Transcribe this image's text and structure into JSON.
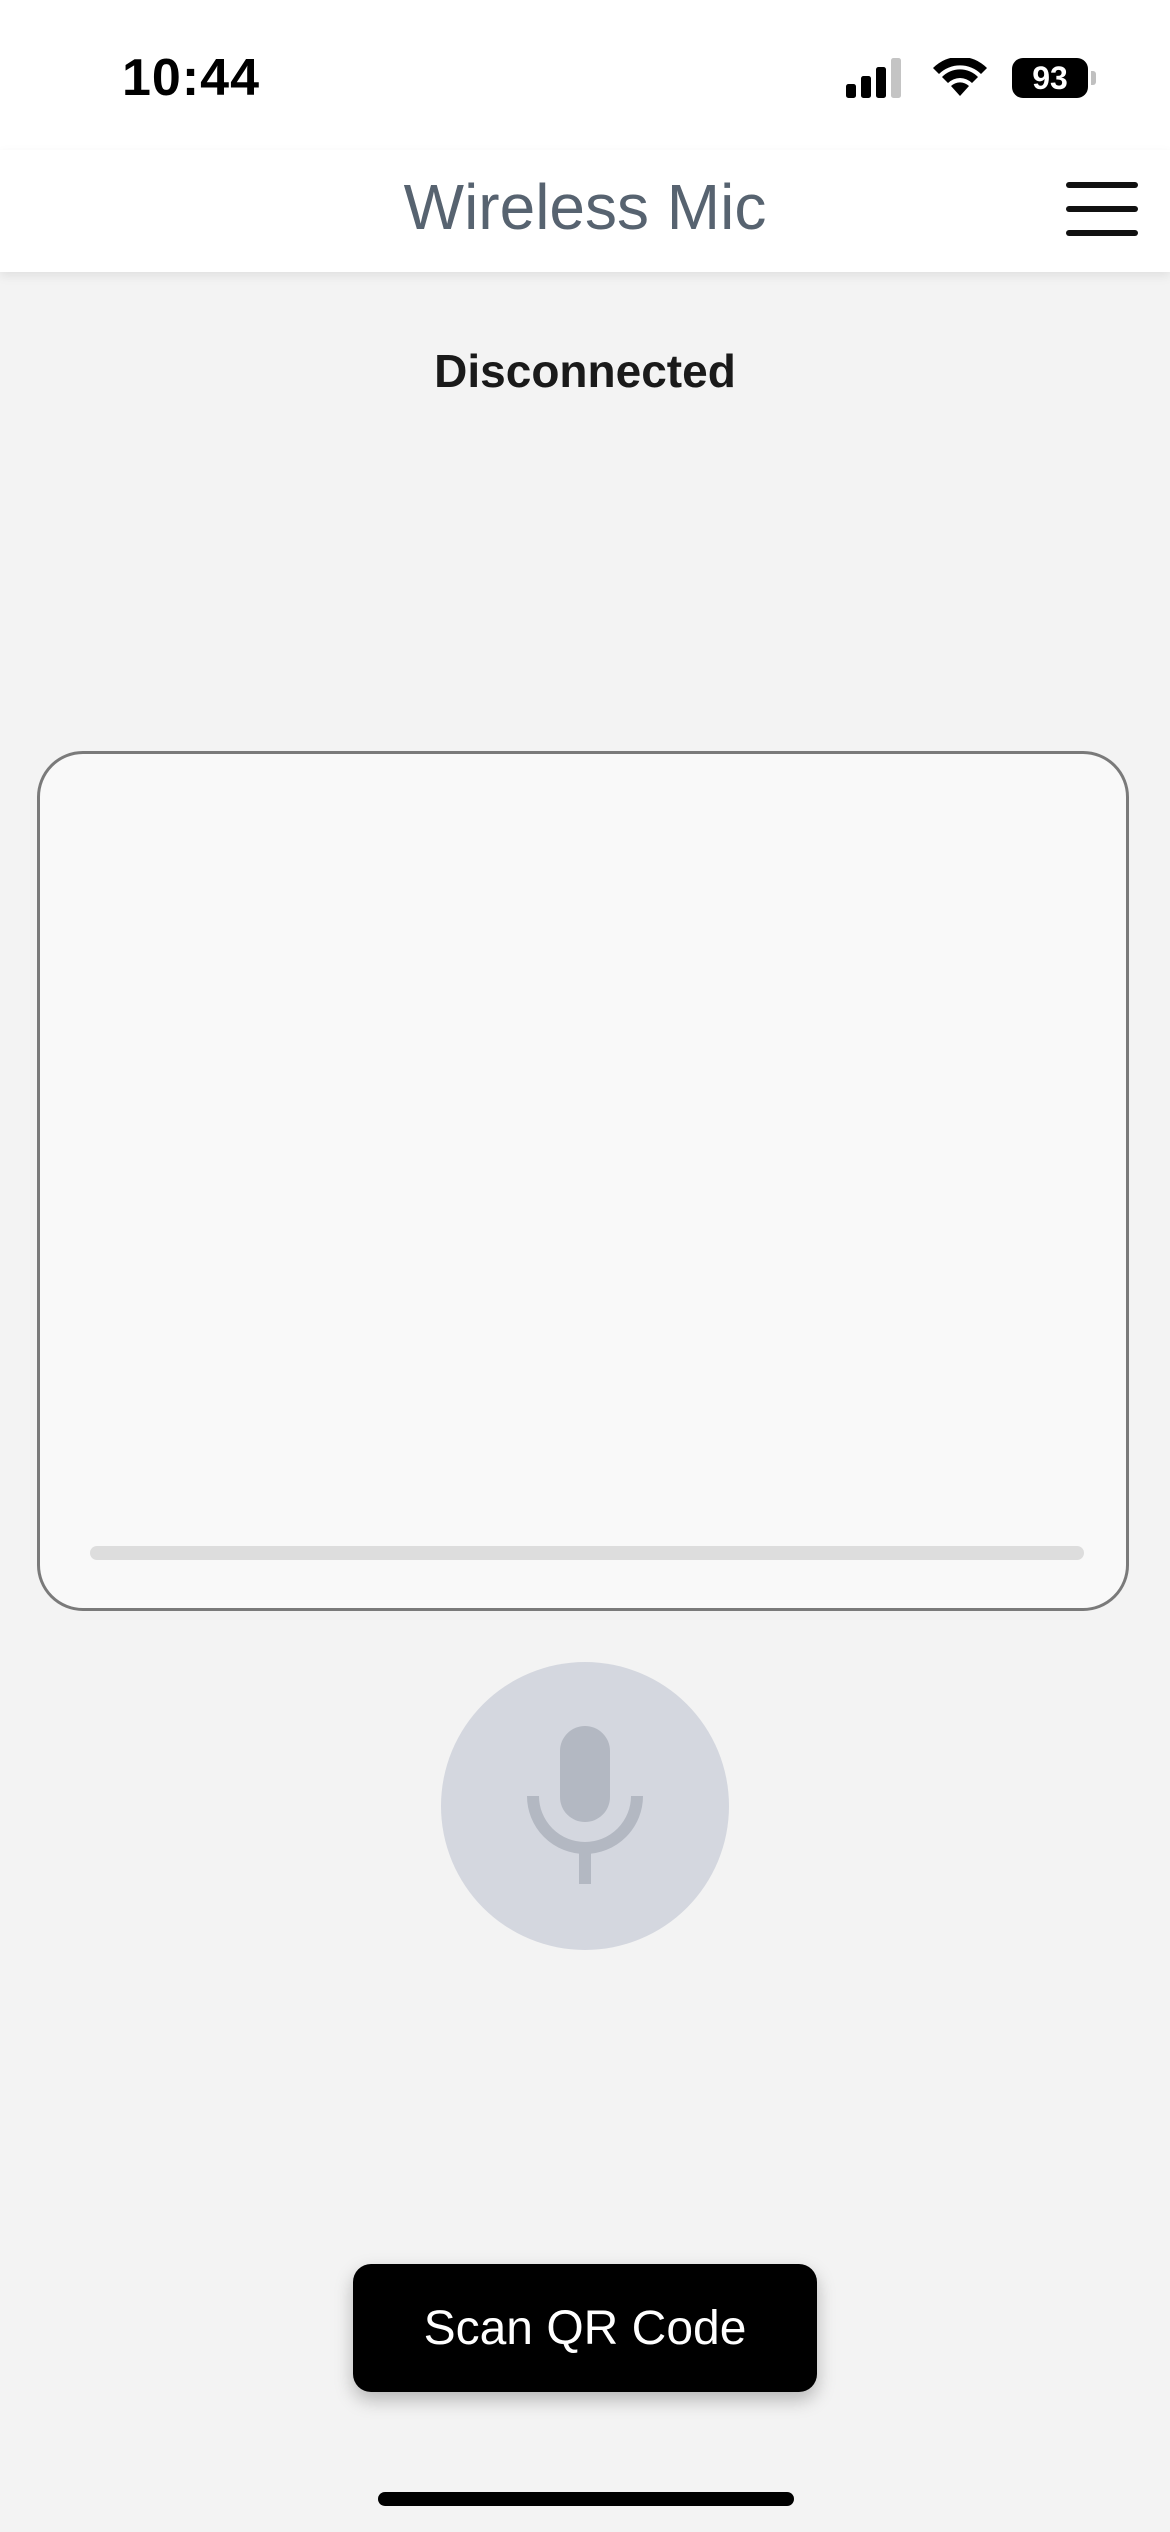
{
  "status_bar": {
    "time": "10:44",
    "battery": "93",
    "icons": [
      "cellular-signal-icon",
      "wifi-icon",
      "battery-icon"
    ]
  },
  "header": {
    "title": "Wireless Mic",
    "menu_icon": "hamburger-menu-icon"
  },
  "main": {
    "connection_status": "Disconnected",
    "mic_icon": "microphone-icon",
    "mic_enabled": false
  },
  "footer": {
    "scan_label": "Scan QR Code"
  },
  "colors": {
    "title": "#576370",
    "background": "#f3f3f3",
    "mic_button_bg": "#d4d7df",
    "mic_icon": "#b3b8c2",
    "scan_button_bg": "#000000"
  }
}
